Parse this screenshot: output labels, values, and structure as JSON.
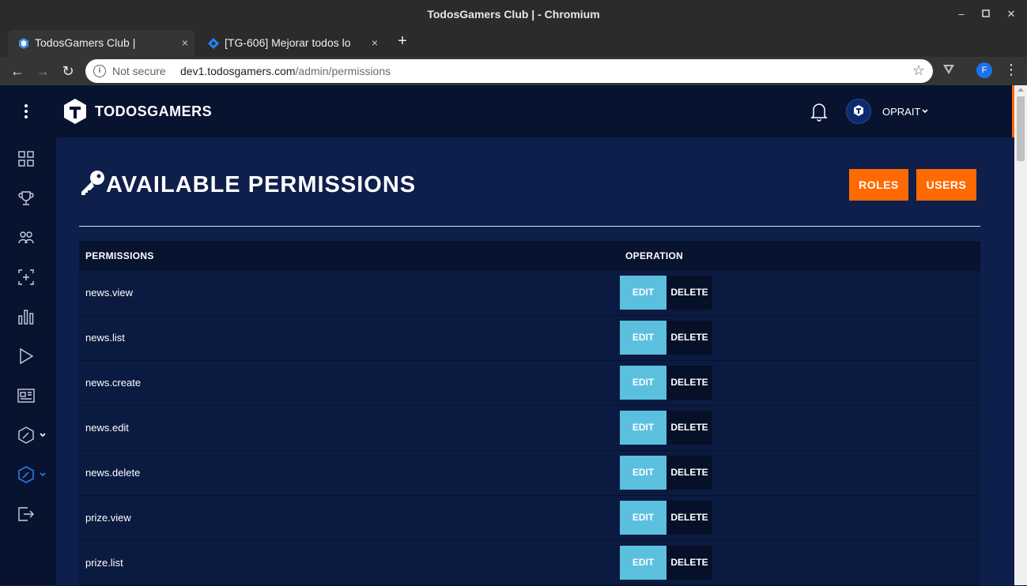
{
  "window": {
    "title": "TodosGamers Club | - Chromium"
  },
  "tabs": [
    {
      "label": "TodosGamers Club |",
      "close": "×"
    },
    {
      "label": "[TG-606] Mejorar todos lo",
      "close": "×"
    }
  ],
  "new_tab_label": "+",
  "omnibox": {
    "security_label": "Not secure",
    "url_host": "dev1.todosgamers.com",
    "url_path": "/admin/permissions"
  },
  "profile_initial": "F",
  "app": {
    "brand": "TODOSGAMERS",
    "username": "OPRAIT",
    "page_title": "AVAILABLE PERMISSIONS",
    "buttons": {
      "roles": "ROLES",
      "users": "USERS"
    },
    "table": {
      "headers": {
        "permissions": "PERMISSIONS",
        "operation": "OPERATION"
      },
      "edit_label": "EDIT",
      "delete_label": "DELETE",
      "rows": [
        {
          "permission": "news.view"
        },
        {
          "permission": "news.list"
        },
        {
          "permission": "news.create"
        },
        {
          "permission": "news.edit"
        },
        {
          "permission": "news.delete"
        },
        {
          "permission": "prize.view"
        },
        {
          "permission": "prize.list"
        }
      ]
    }
  },
  "colors": {
    "accent_orange": "#ff6a00",
    "edit_blue": "#5bc0de",
    "nav_dark": "#081330",
    "page_bg": "#0e1f4c"
  }
}
